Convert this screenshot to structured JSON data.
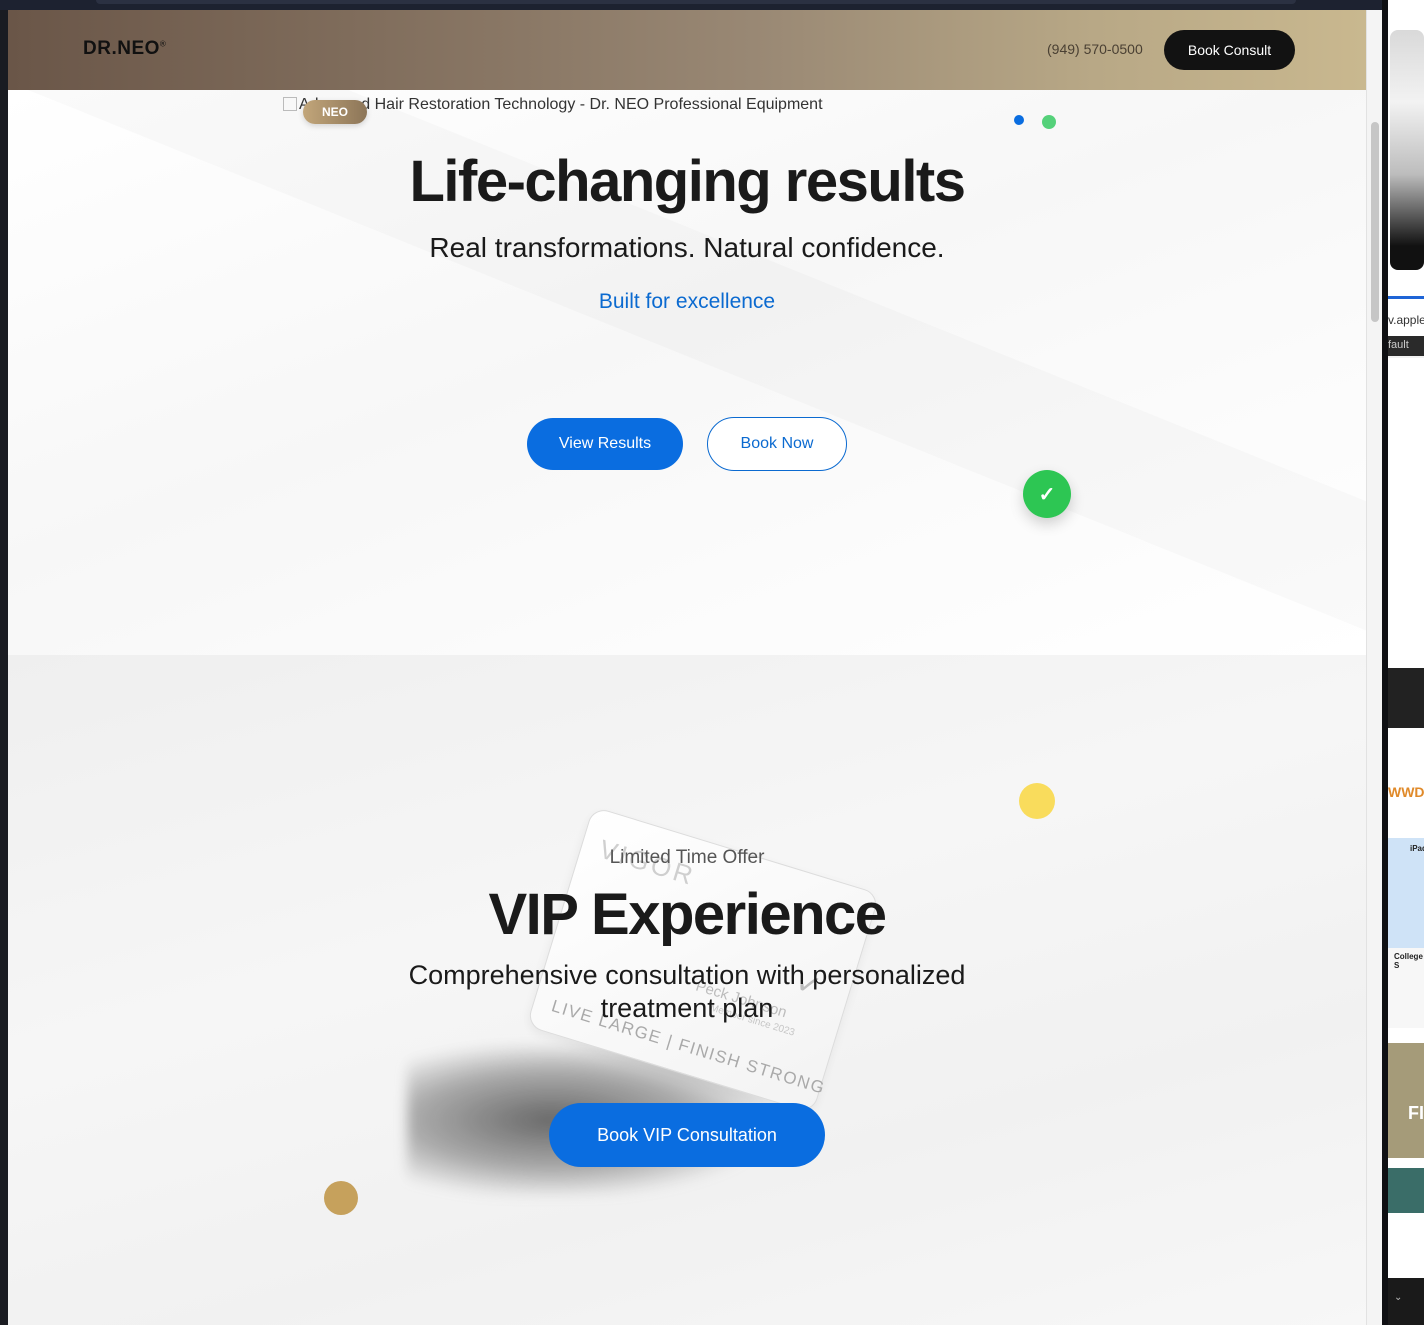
{
  "header": {
    "logo": "DR.NEO",
    "logo_mark": "®",
    "phone": "(949) 570-0500",
    "book_consult_label": "Book Consult"
  },
  "hero": {
    "broken_image_alt": "Advanced Hair Restoration Technology - Dr. NEO Professional Equipment",
    "badge": "NEO",
    "title": "Life-changing results",
    "subtitle": "Real transformations. Natural confidence.",
    "link": "Built for excellence",
    "primary_button": "View Results",
    "secondary_button": "Book Now",
    "check_icon": "✓"
  },
  "vip": {
    "label": "Limited Time Offer",
    "title": "VIP Experience",
    "description": "Comprehensive consultation with personalized treatment plan",
    "button": "Book VIP Consultation",
    "card": {
      "brand": "VIGOR",
      "mark": "✓",
      "name": "Peck Johnson",
      "since": "Member since 2023",
      "tagline": "LIVE LARGE | FINISH STRONG"
    }
  },
  "side_window": {
    "url_fragment": "v.apple",
    "tab_fragment": "fault",
    "labels": [
      "WWD",
      "iPad",
      "College S",
      "FI"
    ]
  },
  "colors": {
    "accent_blue": "#0a6de0",
    "success_green": "#2dc653",
    "header_gradient_start": "#6a5648",
    "header_gradient_end": "#c9b88f",
    "highlight_yellow": "#f9dc5c",
    "tan": "#c6a15c"
  }
}
